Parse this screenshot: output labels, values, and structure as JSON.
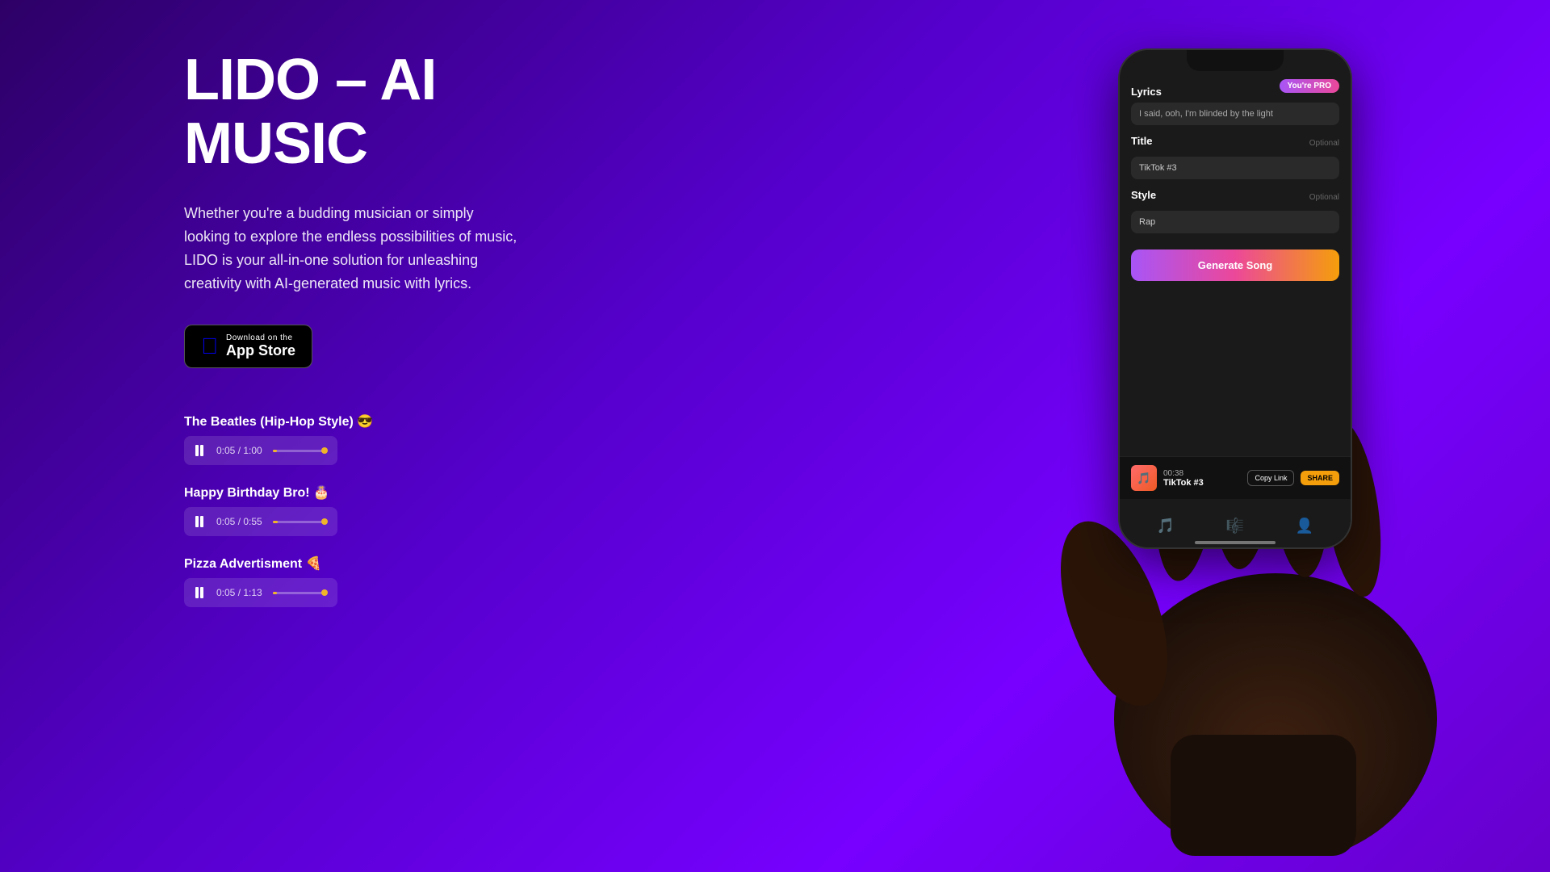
{
  "hero": {
    "title": "LIDO – AI\nMUSIC",
    "description": "Whether you're a budding musician or simply looking to explore the endless possibilities of music, LIDO is your all-in-one solution for unleashing creativity with AI-generated music with lyrics.",
    "app_store_label": "Download on the",
    "app_store_name": "App Store"
  },
  "tracks": [
    {
      "title": "The Beatles (Hip-Hop Style) 😎",
      "time": "0:05 / 1:00",
      "progress": 8
    },
    {
      "title": "Happy Birthday Bro! 🎂",
      "time": "0:05 / 0:55",
      "progress": 9
    },
    {
      "title": "Pizza Advertisment 🍕",
      "time": "0:05 / 1:13",
      "progress": 7
    }
  ],
  "phone": {
    "pro_badge": "You're PRO",
    "lyrics_label": "Lyrics",
    "lyrics_value": "I said, ooh, I'm blinded by the light",
    "title_label": "Title",
    "title_optional": "Optional",
    "title_value": "TikTok #3",
    "style_label": "Style",
    "style_optional": "Optional",
    "style_value": "Rap",
    "generate_btn": "Generate Song",
    "now_playing_time": "00:38",
    "now_playing_title": "TikTok #3",
    "copy_link": "Copy Link",
    "share": "SHARE"
  }
}
